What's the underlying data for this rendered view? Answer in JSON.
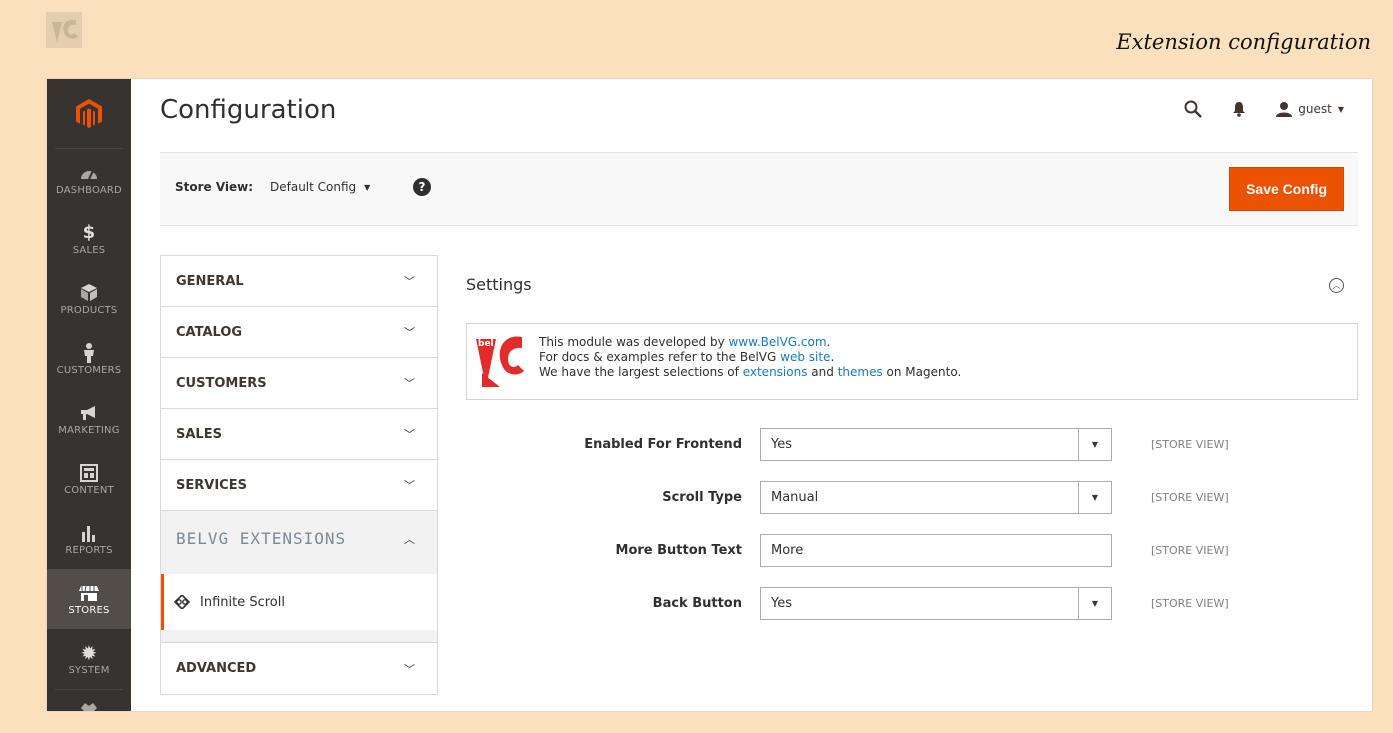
{
  "page_caption": "Extension configuration",
  "sidebar": {
    "items": [
      {
        "label": "DASHBOARD",
        "icon": "dashboard-icon"
      },
      {
        "label": "SALES",
        "icon": "dollar-icon"
      },
      {
        "label": "PRODUCTS",
        "icon": "cube-icon"
      },
      {
        "label": "CUSTOMERS",
        "icon": "person-icon"
      },
      {
        "label": "MARKETING",
        "icon": "megaphone-icon"
      },
      {
        "label": "CONTENT",
        "icon": "layout-icon"
      },
      {
        "label": "REPORTS",
        "icon": "bar-chart-icon"
      },
      {
        "label": "STORES",
        "icon": "store-icon",
        "active": true
      },
      {
        "label": "SYSTEM",
        "icon": "gear-icon"
      }
    ]
  },
  "header": {
    "title": "Configuration",
    "user": "guest"
  },
  "page_actions": {
    "store_view_label": "Store View:",
    "store_view_value": "Default Config",
    "help_symbol": "?",
    "save_label": "Save Config"
  },
  "tabs": {
    "items": [
      {
        "label": "GENERAL"
      },
      {
        "label": "CATALOG"
      },
      {
        "label": "CUSTOMERS"
      },
      {
        "label": "SALES"
      },
      {
        "label": "SERVICES"
      }
    ],
    "open_tab": "BELVG EXTENSIONS",
    "subtab": "Infinite Scroll",
    "last_tab": "ADVANCED"
  },
  "settings": {
    "title": "Settings",
    "info": {
      "line1_prefix": "This module was developed by ",
      "line1_link": "www.BelVG.com",
      "line1_suffix": ".",
      "line2_prefix": "For docs & examples refer to the BelVG ",
      "line2_link": "web site",
      "line2_suffix": ".",
      "line3_prefix": "We have the largest selections of ",
      "line3_link1": "extensions",
      "line3_mid": " and ",
      "line3_link2": "themes",
      "line3_suffix": " on Magento."
    },
    "fields": [
      {
        "label": "Enabled For Frontend",
        "value": "Yes",
        "type": "select",
        "scope": "[STORE VIEW]"
      },
      {
        "label": "Scroll Type",
        "value": "Manual",
        "type": "select",
        "scope": "[STORE VIEW]"
      },
      {
        "label": "More Button Text",
        "value": "More",
        "type": "text",
        "scope": "[STORE VIEW]"
      },
      {
        "label": "Back Button",
        "value": "Yes",
        "type": "select",
        "scope": "[STORE VIEW]"
      }
    ]
  },
  "colors": {
    "accent": "#eb5202",
    "sidebar": "#373330",
    "link": "#1979c3",
    "background": "#fae0bd"
  }
}
